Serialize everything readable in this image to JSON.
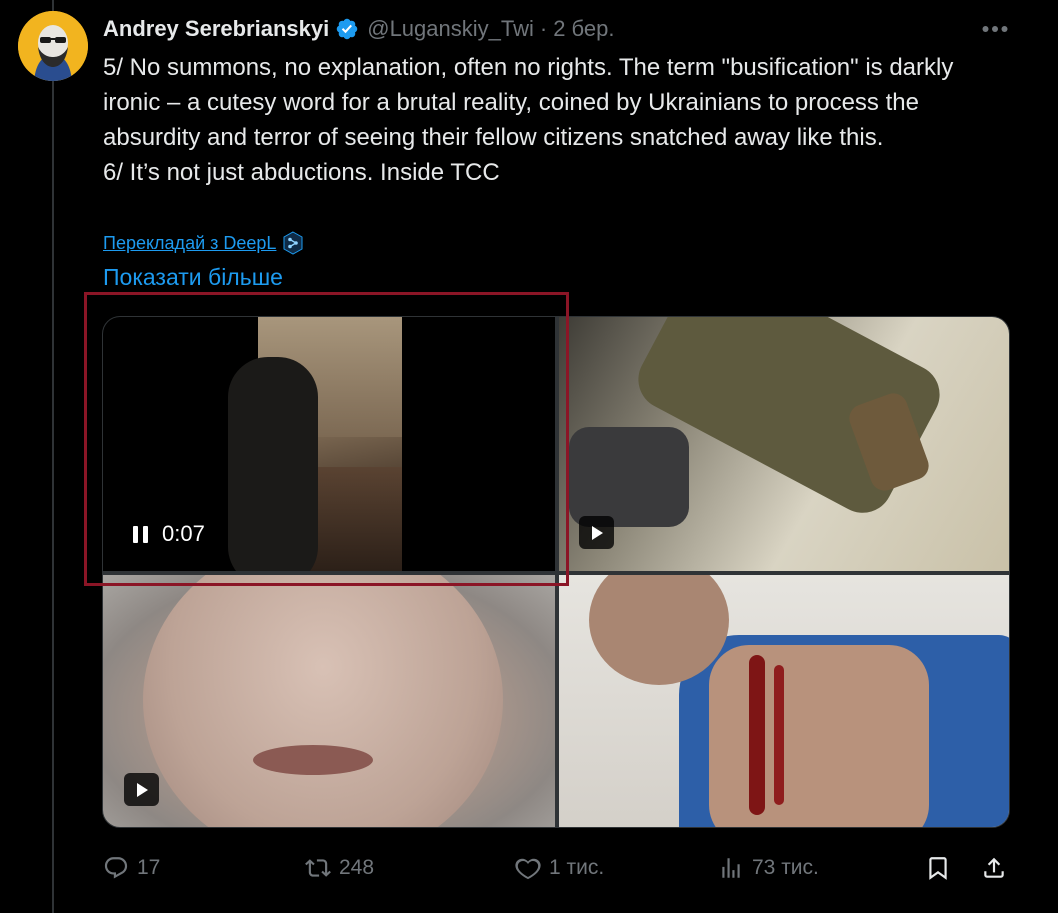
{
  "author": {
    "name": "Andrey Serebrianskyi",
    "handle": "@Luganskiy_Twi",
    "separator": "·",
    "time": "2 бер."
  },
  "tweet": {
    "paragraphs": [
      "5/ No summons, no explanation, often no rights. The term \"busification\" is darkly ironic – a cutesy word for a brutal reality, coined by Ukrainians to process the absurdity and terror of seeing their fellow citizens snatched away like this.",
      "6/ It’s not just abductions. Inside TCC"
    ],
    "translate_label": "Перекладай з DeepL",
    "show_more_label": "Показати більше"
  },
  "media": {
    "video1": {
      "timecode": "0:07",
      "state": "playing"
    }
  },
  "actions": {
    "replies": "17",
    "reposts": "248",
    "likes": "1 тис.",
    "views": "73 тис."
  },
  "colors": {
    "accent": "#1d9bf0",
    "muted": "#71767b",
    "text": "#e7e9ea",
    "highlight_box": "#8b1526",
    "background": "#000000"
  },
  "icons": [
    "more-icon",
    "verified-badge-icon",
    "deepl-icon",
    "pause-icon",
    "play-icon",
    "reply-icon",
    "repost-icon",
    "like-icon",
    "views-icon",
    "bookmark-icon",
    "share-icon"
  ]
}
